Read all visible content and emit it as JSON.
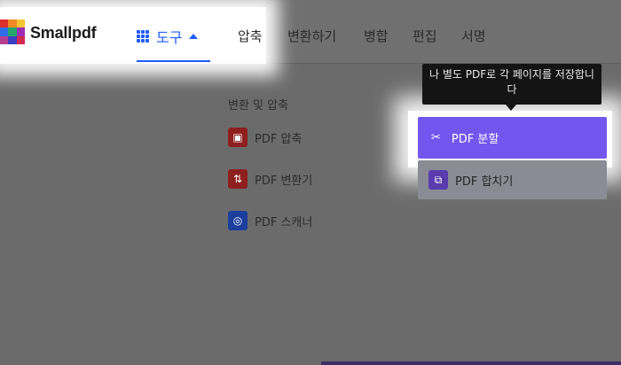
{
  "header": {
    "brand": "Smallpdf",
    "tools_label": "도구",
    "nav": [
      "압축",
      "변환하기",
      "병합",
      "편집",
      "서명"
    ]
  },
  "menu": {
    "section_title": "변환 및 압축",
    "items": [
      {
        "label": "PDF 압축",
        "icon": "compress-icon",
        "color": "#8e1f1f"
      },
      {
        "label": "PDF 변환기",
        "icon": "convert-icon",
        "color": "#8e1f1f"
      },
      {
        "label": "PDF 스캐너",
        "icon": "scanner-icon",
        "color": "#1c3f9c"
      }
    ]
  },
  "right": {
    "tooltip": "나 별도 PDF로 각 페이지를 저장합니다",
    "split_label": "PDF 분할",
    "merge_label": "PDF 합치기"
  },
  "colors": {
    "accent": "#1e5cff",
    "split": "#7257ee",
    "merge_icon": "#5b3cae"
  }
}
